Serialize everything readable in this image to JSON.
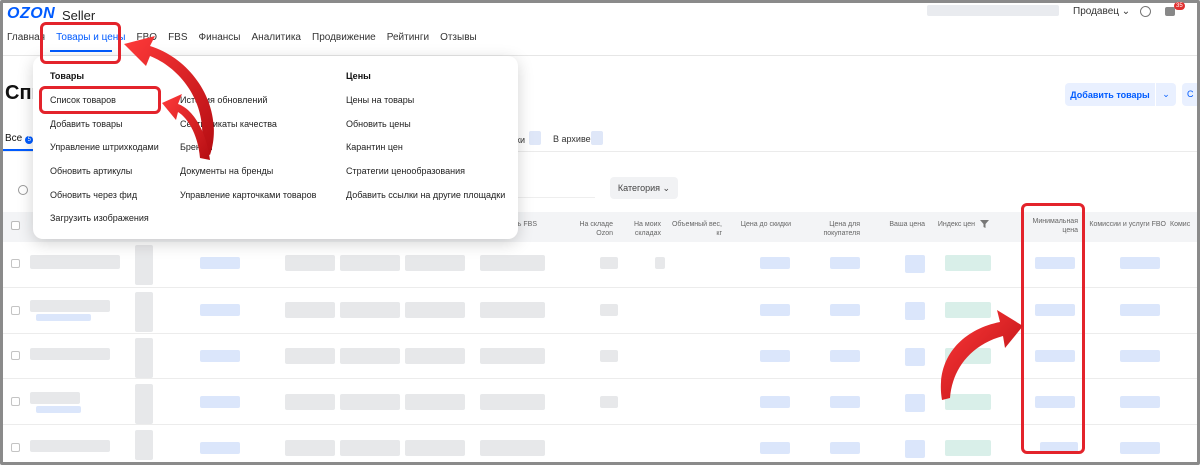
{
  "header": {
    "logo": "OZON",
    "logo_suffix": "Seller",
    "account_label": "Продавец",
    "notification_count": "35",
    "nav": [
      "Главная",
      "Товары и цены",
      "FBO",
      "FBS",
      "Финансы",
      "Аналитика",
      "Продвижение",
      "Рейтинги",
      "Отзывы"
    ],
    "nav_active": "Товары и цены"
  },
  "page": {
    "title": "Спи",
    "add_button": "Добавить товары",
    "add_button_caret": "⌄",
    "extra_button": "С",
    "tabs": {
      "all": "Все",
      "all_count": "5",
      "tab_ki": "ки",
      "archive": "В архиве"
    },
    "category_button": "Категория",
    "category_caret": "⌄"
  },
  "table": {
    "headers": {
      "fbs": "ь FBS",
      "ozon_stock": "На складе Ozon",
      "my_stock": "На моих складах",
      "volume": "Объемный вес, кг",
      "price_before": "Цена до скидки",
      "buyer_price": "Цена для покупателя",
      "your_price": "Ваша цена",
      "price_index": "Индекс цен",
      "min_price": "Минимальная цена",
      "fbo_fees": "Комиссии и услуги FBO",
      "fbs_fees": "Комис"
    }
  },
  "dropdown": {
    "col1_title": "Товары",
    "col1": [
      "Список товаров",
      "Добавить товары",
      "Управление штрихкодами",
      "Обновить артикулы",
      "Обновить через фид",
      "Загрузить изображения"
    ],
    "col2": [
      "История обновлений",
      "Сертификаты качества",
      "Бренды",
      "Документы на бренды",
      "Управление карточками товаров"
    ],
    "col3_title": "Цены",
    "col3": [
      "Цены на товары",
      "Обновить цены",
      "Карантин цен",
      "Стратегии ценообразования",
      "Добавить ссылки на другие площадки"
    ]
  },
  "colors": {
    "accent": "#005bff",
    "annotation": "#e3232b"
  }
}
